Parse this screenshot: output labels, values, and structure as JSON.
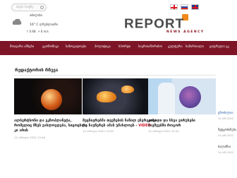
{
  "header": {
    "search_placeholder": "ძიება საიტზე",
    "weather": {
      "city": "თბილისი",
      "temperature": "16°",
      "temperature_unit": "C ღრუბლიანი",
      "wind_direction": "0.68",
      "wind_speed": "6 m/s"
    },
    "logo_text": "REPORT",
    "logo_subtitle": "NEWS AGENCY"
  },
  "nav": {
    "items": [
      "მთავარი ამბები",
      "ეკონომიკა",
      "საზოგადოება",
      "პოლიტიკა",
      "სპორტი",
      "საერთაშორისო",
      "კულტურა",
      "სამართალი",
      "ციფრული ეკ"
    ]
  },
  "section": {
    "title": "რედაქტორის რჩევა"
  },
  "cards": [
    {
      "title_line1": "ალბერტსონი და ეკზოპლანეტა,",
      "title_line2": "რომელიც მზეს უახლოვდება, სიცოცხლე",
      "title_line3": "კი არის",
      "date": "14 აპრილი 2022 13:46"
    },
    {
      "title_line1": "მეცნიერებმა თევზების ნაწილ ენერგიისა",
      "title_line2": "რა ჩაუწერეს ამას უმახლოეს -",
      "video_tag": "VIDEO",
      "date": "14 აპრილი 2022 13:00"
    },
    {
      "title_line1": "კოვიდი და სხვა ვირუსები",
      "title_line2": "ბავშვებში როგორ",
      "date": "14 აპრილი 2022 12:42"
    }
  ],
  "sidebar": {
    "items": [
      {
        "date": "14 აპრ 2022",
        "text": "ცნობილია"
      },
      {
        "date": "14 აპრ 2022",
        "text": "შეტყობინება"
      },
      {
        "date": "14 აპრ 2022",
        "text": "ბალანსი"
      }
    ]
  }
}
